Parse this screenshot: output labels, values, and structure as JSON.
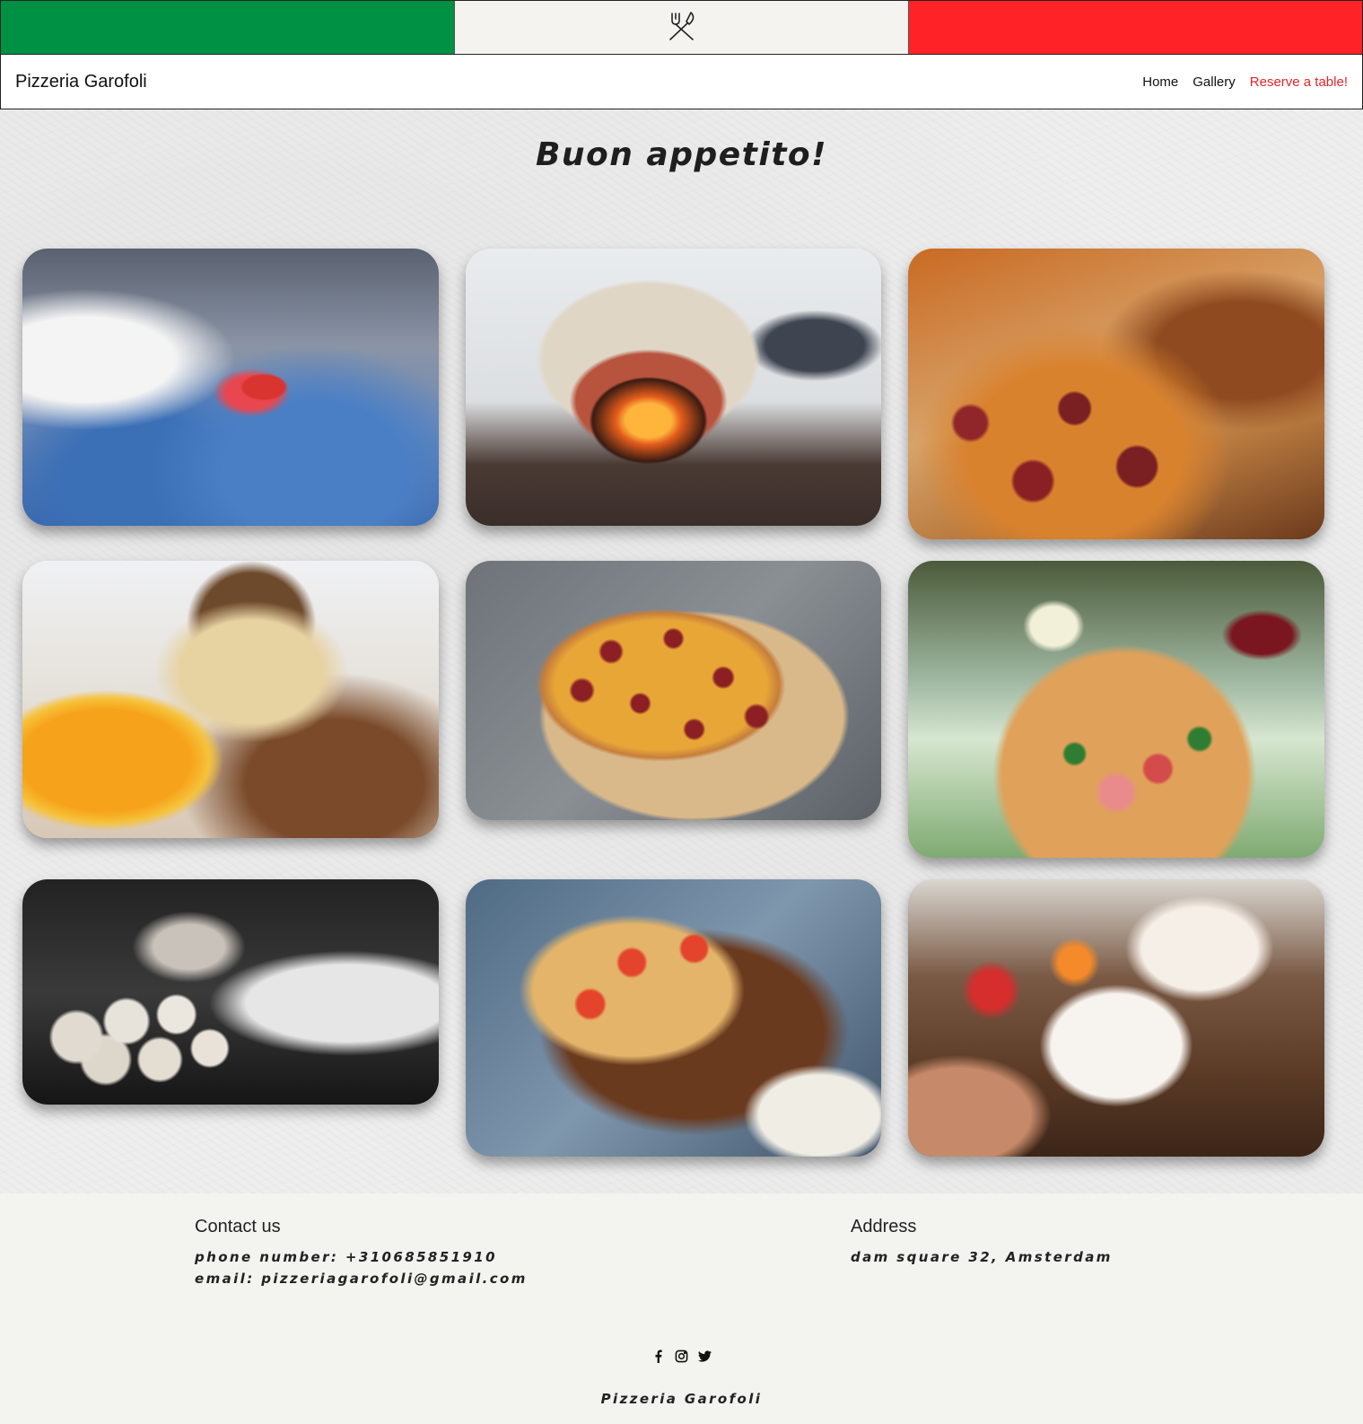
{
  "flag": {
    "colors": [
      "#009145",
      "#f4f3ef",
      "#ff2328"
    ],
    "center_icon": "fork-knife-icon"
  },
  "nav": {
    "brand": "Pizzeria Garofoli",
    "links": [
      {
        "label": "Home"
      },
      {
        "label": "Gallery"
      },
      {
        "label": "Reserve a table!",
        "active_color": "#e0262a"
      }
    ]
  },
  "gallery": {
    "heading": "Buon appetito!",
    "images": [
      {
        "subject": "chef-cutting-tomatoes"
      },
      {
        "subject": "wood-fired-pizza-oven"
      },
      {
        "subject": "pepperoni-pizza-closeup"
      },
      {
        "subject": "tiramisu-with-orange"
      },
      {
        "subject": "pepperoni-pizza-on-board"
      },
      {
        "subject": "prosciutto-arugula-pizza-table"
      },
      {
        "subject": "dough-balls-tray"
      },
      {
        "subject": "focaccia-with-tomatoes"
      },
      {
        "subject": "antipasto-platter"
      }
    ]
  },
  "footer": {
    "contact": {
      "title": "Contact us",
      "phone": "phone number: +310685851910",
      "email": "email: pizzeriagarofoli@gmail.com"
    },
    "address": {
      "title": "Address",
      "line": "dam square 32, Amsterdam"
    },
    "social_icons": [
      "facebook-icon",
      "instagram-icon",
      "twitter-icon"
    ],
    "copyright": "Pizzeria Garofoli"
  }
}
